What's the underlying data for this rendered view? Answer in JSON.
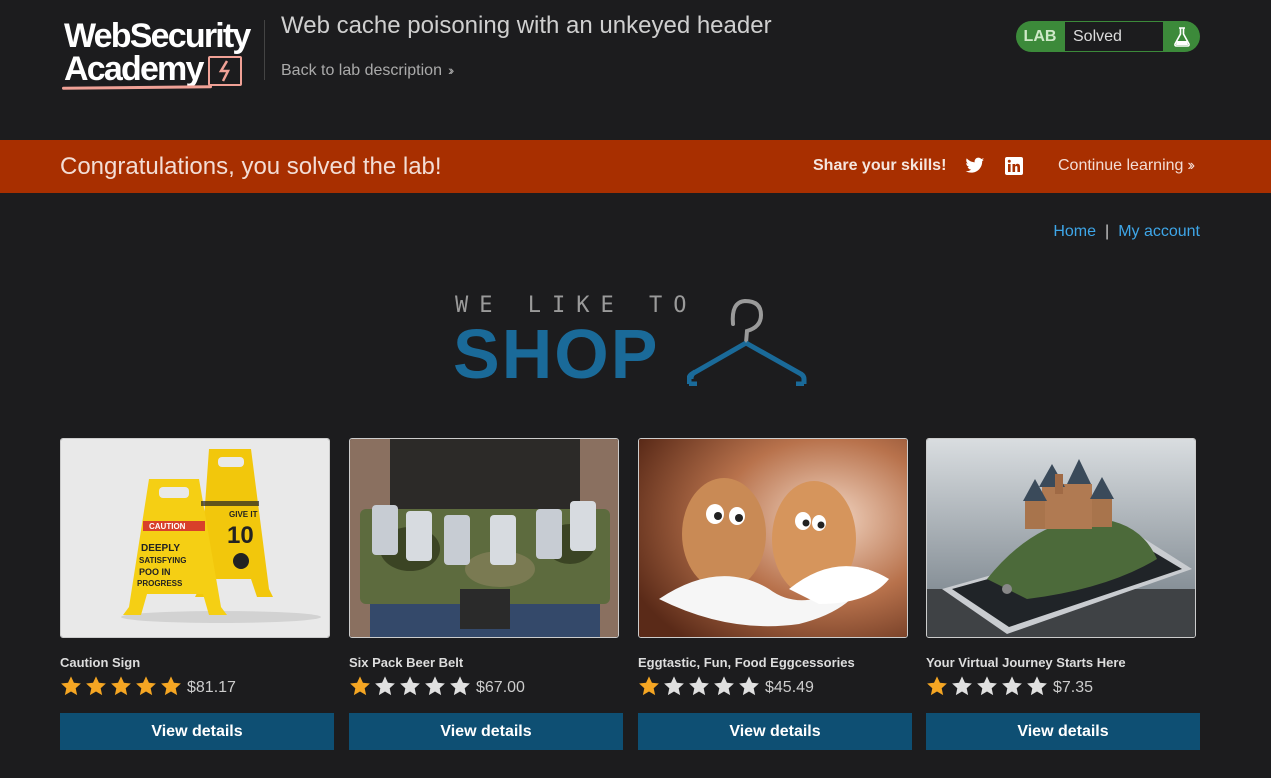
{
  "header": {
    "logo_line1": "WebSecurity",
    "logo_line2": "Academy",
    "lab_title": "Web cache poisoning with an unkeyed header",
    "back_link": "Back to lab description",
    "lab_badge": "LAB",
    "lab_status": "Solved",
    "status_color": "#3c8a3a"
  },
  "banner": {
    "message": "Congratulations, you solved the lab!",
    "share_label": "Share your skills!",
    "continue_label": "Continue learning",
    "background_color": "#a82f00"
  },
  "nav": {
    "home": "Home",
    "separator": "|",
    "my_account": "My account"
  },
  "shop_logo": {
    "tagline": "WE LIKE TO",
    "word": "SHOP"
  },
  "products": [
    {
      "name": "Caution Sign",
      "rating": 5,
      "price": "$81.17",
      "button": "View details"
    },
    {
      "name": "Six Pack Beer Belt",
      "rating": 1,
      "price": "$67.00",
      "button": "View details"
    },
    {
      "name": "Eggtastic, Fun, Food Eggcessories",
      "rating": 1,
      "price": "$45.49",
      "button": "View details"
    },
    {
      "name": "Your Virtual Journey Starts Here",
      "rating": 1,
      "price": "$7.35",
      "button": "View details"
    }
  ],
  "colors": {
    "accent_button": "#0e4f73",
    "link": "#3ea6e8",
    "star_filled": "#f5a623",
    "star_empty": "#e0e0e0"
  }
}
